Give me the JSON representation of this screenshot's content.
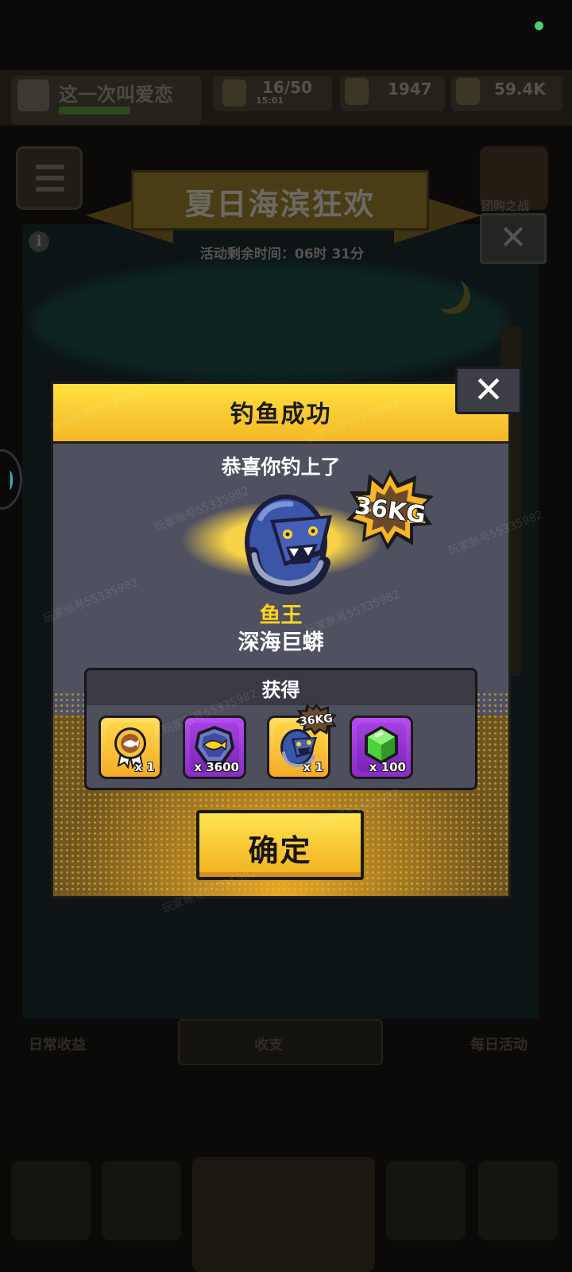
{
  "background": {
    "player_name": "这一次叫爱恋",
    "energy": "16/50",
    "energy_timer": "15:01",
    "resource_1": "1947",
    "resource_2": "59.4K",
    "guild_label": "团购之战",
    "event_title": "夏日海滨狂欢",
    "event_timer": "活动剩余时间：06时 31分",
    "tab_left": "日常收益",
    "tab_center": "收支",
    "tab_right": "每日活动"
  },
  "dialog": {
    "title": "钓鱼成功",
    "congrats": "恭喜你钓上了",
    "weight_badge": "36KG",
    "rarity": "鱼王",
    "fish_name": "深海巨蟒",
    "reward_title": "获得",
    "rewards": [
      {
        "icon": "fish-medal-icon",
        "count": "x 1",
        "frame": "gold"
      },
      {
        "icon": "fish-coin-icon",
        "count": "x 3600",
        "frame": "purple"
      },
      {
        "icon": "sea-serpent-icon",
        "count": "x 1",
        "frame": "gold",
        "badge": "36KG"
      },
      {
        "icon": "green-gem-icon",
        "count": "x 100",
        "frame": "purple"
      }
    ],
    "confirm_label": "确定"
  },
  "watermark": "玩家账号55335982",
  "colors": {
    "dialog_yellow": "#f9cc34",
    "dialog_body": "#4f5060",
    "rarity_gold": "#ffd21f",
    "reward_purple": "#9a38d8",
    "gem_green": "#4bd13c"
  }
}
